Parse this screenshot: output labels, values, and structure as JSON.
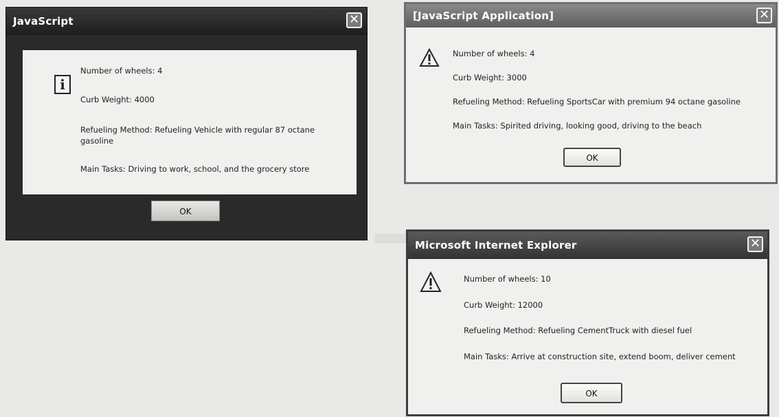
{
  "dialogs": [
    {
      "title": "JavaScript",
      "close_glyph": "✕",
      "icon": "info-icon",
      "lines": [
        "Number of wheels: 4",
        "Curb Weight: 4000",
        "Refueling Method: Refueling Vehicle with regular 87 octane gasoline",
        "Main Tasks: Driving to work, school, and the grocery store"
      ],
      "ok_label": "OK"
    },
    {
      "title": "[JavaScript Application]",
      "close_glyph": "✕",
      "icon": "warning-icon",
      "lines": [
        "Number of wheels: 4",
        "Curb Weight: 3000",
        "Refueling Method: Refueling SportsCar with premium 94 octane gasoline",
        "Main Tasks: Spirited driving, looking good, driving to the beach"
      ],
      "ok_label": "OK"
    },
    {
      "title": "Microsoft Internet Explorer",
      "close_glyph": "✕",
      "icon": "warning-icon",
      "lines": [
        "Number of wheels: 10",
        "Curb Weight: 12000",
        "Refueling Method: Refueling CementTruck with diesel fuel",
        "Main Tasks: Arrive at construction site, extend boom, deliver cement"
      ],
      "ok_label": "OK"
    }
  ],
  "colors": {
    "dialog1_frame": "#2a2a2a",
    "dialog1_body": "#f0f0ee",
    "dialog2_frame": "#6e6e6e",
    "dialog3_frame": "#3c3c3c",
    "page_background": "#e9e9e7"
  }
}
